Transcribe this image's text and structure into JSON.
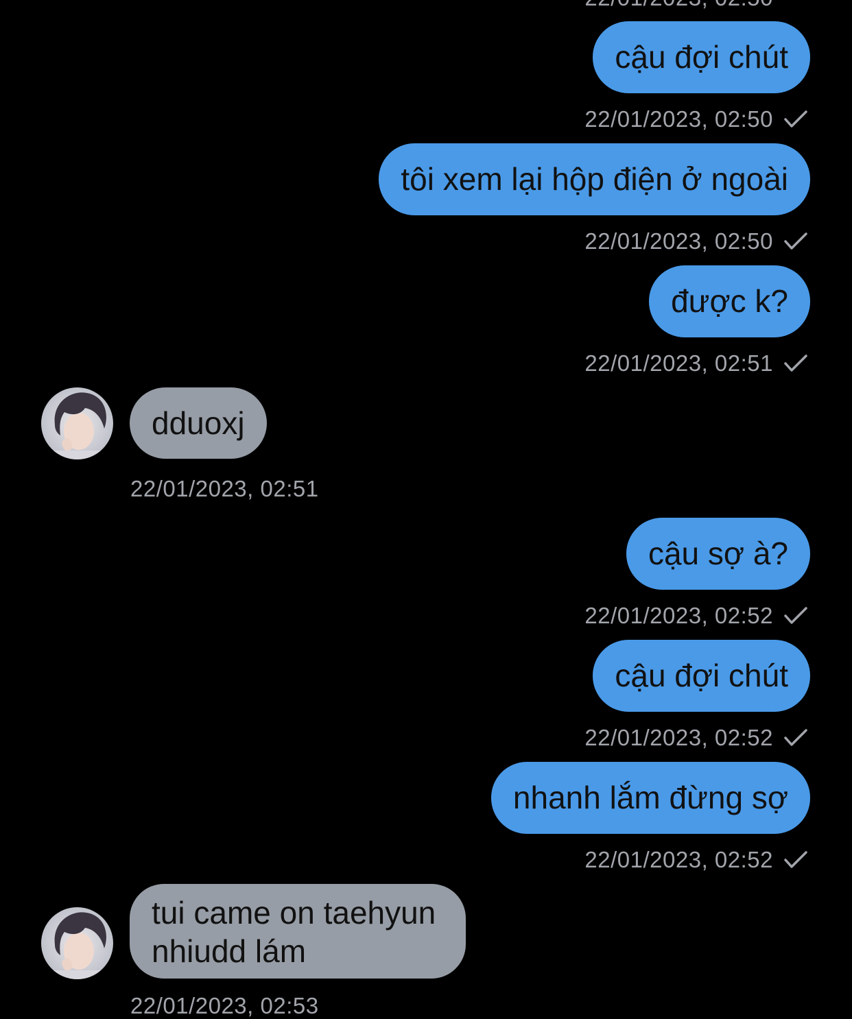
{
  "conversation": {
    "top_partial_timestamp": "22/01/2023, 02:50",
    "messages": [
      {
        "direction": "out",
        "text": "cậu đợi chút",
        "timestamp": "22/01/2023, 02:50",
        "status_icon": "check-icon"
      },
      {
        "direction": "out",
        "text": "tôi xem lại hộp điện ở ngoài",
        "timestamp": "22/01/2023, 02:50",
        "status_icon": "check-icon"
      },
      {
        "direction": "out",
        "text": "được k?",
        "timestamp": "22/01/2023, 02:51",
        "status_icon": "check-icon"
      },
      {
        "direction": "in",
        "text": "dduoxj",
        "timestamp": "22/01/2023, 02:51",
        "avatar": "avatar-icon"
      },
      {
        "direction": "out",
        "text": "cậu sợ à?",
        "timestamp": "22/01/2023, 02:52",
        "status_icon": "check-icon"
      },
      {
        "direction": "out",
        "text": "cậu đợi chút",
        "timestamp": "22/01/2023, 02:52",
        "status_icon": "check-icon"
      },
      {
        "direction": "out",
        "text": "nhanh lắm đừng sợ",
        "timestamp": "22/01/2023, 02:52",
        "status_icon": "check-icon"
      },
      {
        "direction": "in",
        "text_lines": [
          "tui came on taehyun",
          "nhiudd lám"
        ],
        "timestamp": "22/01/2023, 02:53",
        "avatar": "avatar-icon"
      }
    ]
  },
  "colors": {
    "background": "#000000",
    "outgoing_bubble": "#4a9ae8",
    "incoming_bubble": "#979da6",
    "timestamp_text": "#a2a5ab",
    "bubble_text": "#111111"
  }
}
